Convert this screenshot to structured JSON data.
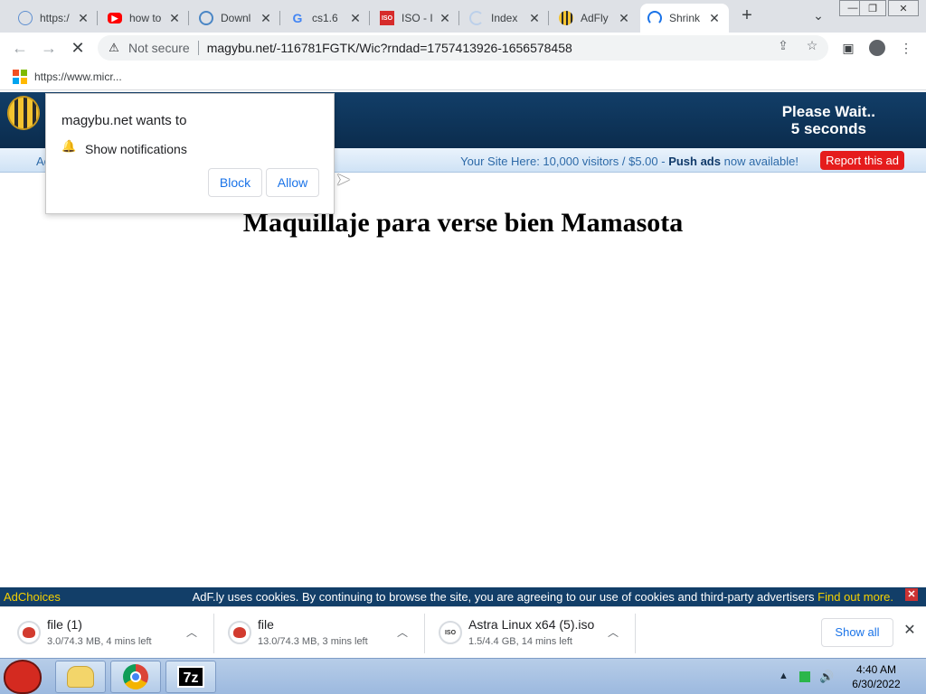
{
  "browser": {
    "tabs": [
      {
        "label": "https:/",
        "favicon": "globe-icon",
        "favicon_color": "#5f8fd0"
      },
      {
        "label": "how to",
        "favicon": "youtube-icon",
        "favicon_color": "#ff0000"
      },
      {
        "label": "Downl",
        "favicon": "edge-icon",
        "favicon_color": "#4a86c5"
      },
      {
        "label": "cs1.6",
        "favicon": "google-icon",
        "favicon_color": "#4285f4"
      },
      {
        "label": "ISO - I",
        "favicon": "iso-icon",
        "favicon_color": "#d62b2b"
      },
      {
        "label": "Index",
        "favicon": "loading-icon",
        "favicon_color": "#bcd0ea"
      },
      {
        "label": "AdFly",
        "favicon": "bee-icon",
        "favicon_color": "#c99a1e"
      },
      {
        "label": "Shrink",
        "favicon": "loading-spinner-icon",
        "favicon_color": "#1a73e8"
      }
    ],
    "new_tab": "+",
    "tab_search": "⌄",
    "window_controls": {
      "minimize": "—",
      "maximize": "❐",
      "close": "✕"
    },
    "not_secure": "Not secure",
    "url": "magybu.net/-116781FGTK/Wic?rndad=1757413926-1656578458",
    "bookmark": "https://www.micr..."
  },
  "site": {
    "please_wait": "Please Wait..",
    "seconds": "5 seconds",
    "ad_left": "Ac",
    "ad_text_prefix": "Your Site Here: 10,000 visitors / $5.00 -",
    "ad_text_bold": "Push ads",
    "ad_text_suffix": "now available!",
    "report_ad": "Report this ad",
    "title": "Maquillaje para verse bien Mamasota"
  },
  "permission_popup": {
    "title": "magybu.net wants to",
    "item": "Show notifications",
    "block": "Block",
    "allow": "Allow"
  },
  "cookie_bar": {
    "adchoices": "AdChoices",
    "text": "AdF.ly uses cookies. By continuing to browse the site, you are agreeing to our use of cookies and third-party advertisers",
    "find_out": "Find out more."
  },
  "downloads": {
    "items": [
      {
        "name": "file (1)",
        "status": "3.0/74.3 MB, 4 mins left"
      },
      {
        "name": "file",
        "status": "13.0/74.3 MB, 3 mins left"
      },
      {
        "name": "Astra Linux x64 (5).iso",
        "status": "1.5/4.4 GB, 14 mins left"
      }
    ],
    "show_all": "Show all"
  },
  "taskbar": {
    "time": "4:40 AM",
    "date": "6/30/2022",
    "pinned": [
      "angry-birds-icon",
      "folder-icon",
      "chrome-icon",
      "7zip-icon"
    ]
  }
}
